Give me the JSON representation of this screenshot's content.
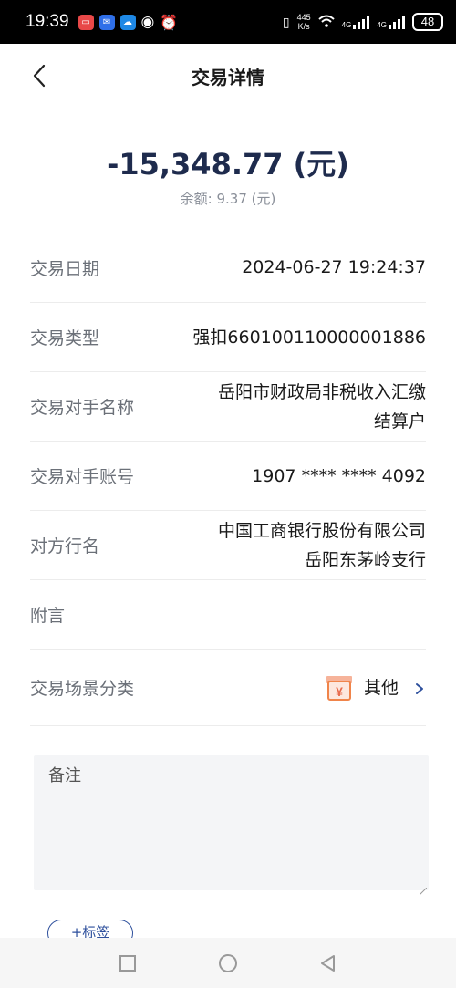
{
  "status_bar": {
    "time": "19:39",
    "net_speed_value": "445",
    "net_speed_unit": "K/s",
    "signal_label_1": "4G",
    "signal_label_2": "4G",
    "battery": "48"
  },
  "header": {
    "title": "交易详情"
  },
  "summary": {
    "amount": "-15,348.77 (元)",
    "balance": "余额: 9.37 (元)"
  },
  "details": {
    "date_label": "交易日期",
    "date_value": "2024-06-27 19:24:37",
    "type_label": "交易类型",
    "type_value": "强扣660100110000001886",
    "counterparty_name_label": "交易对手名称",
    "counterparty_name_line1": "岳阳市财政局非税收入汇缴",
    "counterparty_name_line2": "结算户",
    "counterparty_account_label": "交易对手账号",
    "counterparty_account_value": "1907 **** **** 4092",
    "bank_label": "对方行名",
    "bank_line1": "中国工商银行股份有限公司",
    "bank_line2": "岳阳东茅岭支行",
    "memo_label": "附言",
    "scene_label": "交易场景分类",
    "scene_value": "其他",
    "scene_icon_char": "¥"
  },
  "note": {
    "label": "备注"
  },
  "tag_button": "+标签",
  "colors": {
    "amount": "#1e2b4d",
    "accent": "#2d4f9c",
    "scene_icon": "#f0844a"
  }
}
